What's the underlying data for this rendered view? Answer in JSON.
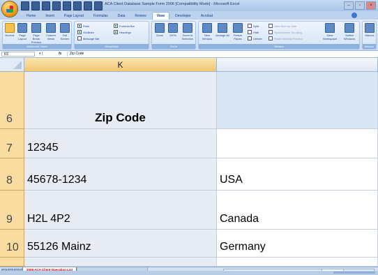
{
  "window": {
    "title": "ACA Client Database Sample Form 2006 [Compatibility Mode] - Microsoft Excel",
    "controls": [
      "–",
      "▫",
      "×"
    ]
  },
  "ribbon": {
    "tabs": [
      "Home",
      "Insert",
      "Page Layout",
      "Formulas",
      "Data",
      "Review",
      "View",
      "Developer",
      "Acrobat"
    ],
    "active_tab": "View",
    "groups": {
      "workbook_views": {
        "label": "Workbook Views",
        "buttons": [
          "Normal",
          "Page Layout",
          "Page Break Preview",
          "Custom Views",
          "Full Screen"
        ]
      },
      "show_hide": {
        "label": "Show/Hide",
        "checks": [
          {
            "label": "Ruler",
            "checked": true
          },
          {
            "label": "Gridlines",
            "checked": true
          },
          {
            "label": "Message Bar",
            "checked": false
          },
          {
            "label": "Formula Bar",
            "checked": true
          },
          {
            "label": "Headings",
            "checked": true
          }
        ]
      },
      "zoom": {
        "label": "Zoom",
        "buttons": [
          "Zoom",
          "100%",
          "Zoom to Selection"
        ]
      },
      "window": {
        "label": "Window",
        "buttons": [
          "New Window",
          "Arrange All",
          "Freeze Panes",
          "Save Workspace",
          "Switch Windows"
        ],
        "small": [
          "Split",
          "Hide",
          "Unhide",
          "View Side by Side",
          "Synchronous Scrolling",
          "Reset Window Position"
        ]
      },
      "macros": {
        "label": "Macros",
        "buttons": [
          "Macros"
        ]
      }
    }
  },
  "formula_bar": {
    "name_box": "K6",
    "fx": "fx",
    "content": "Zip Code"
  },
  "columns": [
    {
      "label": "K",
      "selected": true
    },
    {
      "label": "",
      "selected": false
    }
  ],
  "rows": [
    {
      "num": "6",
      "k": "Zip Code",
      "l": ""
    },
    {
      "num": "7",
      "k": "12345",
      "l": ""
    },
    {
      "num": "8",
      "k": "45678-1234",
      "l": "USA"
    },
    {
      "num": "9",
      "k": "H2L 4P2",
      "l": "Canada"
    },
    {
      "num": "10",
      "k": "55126 Mainz",
      "l": "Germany"
    },
    {
      "num": "",
      "k": "",
      "l": ""
    }
  ],
  "sheet_tabs": {
    "active": "2008 ACA Client Operation List"
  },
  "colors": {
    "accent": "#8db2e3",
    "row_header_selected": "#f9dca0",
    "column_k_fill": "#e6ebf4"
  }
}
